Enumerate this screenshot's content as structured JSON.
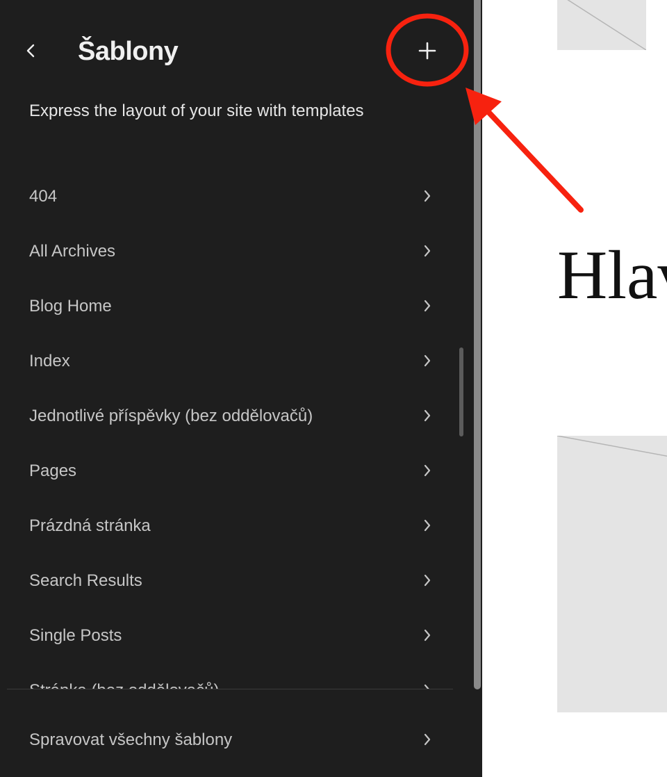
{
  "sidebar": {
    "title": "Šablony",
    "description": "Express the layout of your site with templates",
    "templates": [
      {
        "label": "404"
      },
      {
        "label": "All Archives"
      },
      {
        "label": "Blog Home"
      },
      {
        "label": "Index"
      },
      {
        "label": "Jednotlivé příspěvky (bez oddělovačů)"
      },
      {
        "label": "Pages"
      },
      {
        "label": "Prázdná stránka"
      },
      {
        "label": "Search Results"
      },
      {
        "label": "Single Posts"
      },
      {
        "label": "Stránka (bez oddělovačů)"
      }
    ],
    "footer": {
      "manage_label": "Spravovat všechny šablony"
    },
    "icons": {
      "back": "chevron-left-icon",
      "add": "plus-icon",
      "item": "chevron-right-icon"
    }
  },
  "preview": {
    "heading": "Hlavní"
  },
  "annotation": {
    "color": "#f7220f"
  },
  "colors": {
    "sidebar_bg": "#1e1e1e",
    "title": "#f0f0f0",
    "item_text": "#c6c6c6",
    "placeholder": "#e4e4e4"
  }
}
